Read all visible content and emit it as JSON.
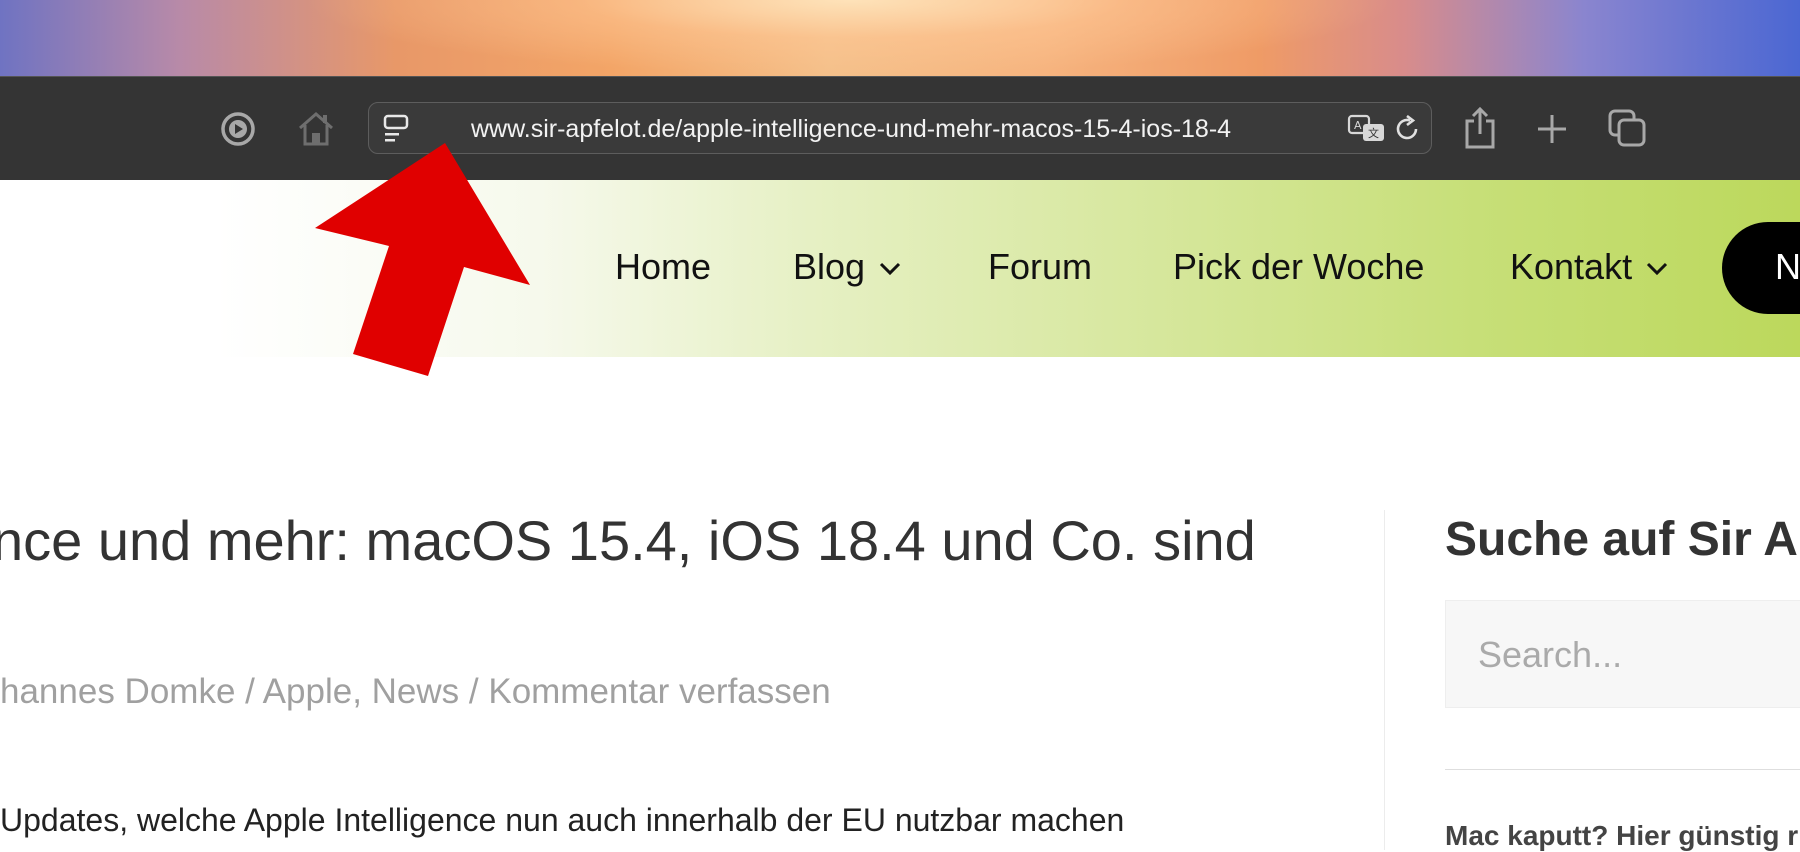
{
  "browser": {
    "url": "www.sir-apfelot.de/apple-intelligence-und-mehr-macos-15-4-ios-18-4",
    "icons": [
      "record-icon",
      "home-icon",
      "reader-icon",
      "translate-icon",
      "reload-icon",
      "share-icon",
      "new-tab-icon",
      "tabs-overview-icon"
    ]
  },
  "nav": {
    "home": "Home",
    "blog": "Blog",
    "forum": "Forum",
    "pick": "Pick der Woche",
    "kontakt": "Kontakt",
    "pill": "N"
  },
  "article": {
    "title": "nce und mehr: macOS 15.4, iOS 18.4 und Co. sind",
    "meta_author": "hannes Domke",
    "meta_sep1": " / ",
    "meta_categories": "Apple, News",
    "meta_sep2": " / ",
    "meta_comment": "Kommentar verfassen",
    "body_line": "Updates, welche Apple Intelligence nun auch innerhalb der EU nutzbar machen"
  },
  "sidebar": {
    "title": "Suche auf Sir A",
    "search_placeholder": "Search...",
    "link": "Mac kaputt? Hier günstig r"
  },
  "colors": {
    "toolbar": "#343434",
    "arrow": "#e00000",
    "pill": "#000000",
    "header_accent": "#bcd85c"
  }
}
